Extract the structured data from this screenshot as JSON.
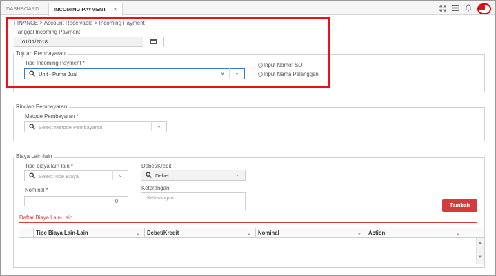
{
  "tabs": {
    "dashboard": "DASHBOARD",
    "incoming": "INCOMING PAYMENT",
    "close": "✕"
  },
  "breadcrumb": "FINANCE > Account Receivable > Incoming Payment",
  "tanggal": {
    "label": "Tanggal Incoming Payment",
    "value": "01/11/2018"
  },
  "tujuan": {
    "legend": "Tujuan Pembayaran",
    "tipe_label": "Tipe Incoming Payment *",
    "tipe_value": "Unit - Purna Jual",
    "radio_so": "Input Nomor SO",
    "radio_pelanggan": "Input Nama Pelanggan"
  },
  "rincian": {
    "legend": "Rincian Pembayaran",
    "metode_label": "Metode Pembayaran *",
    "metode_placeholder": "Select Metode Pembayaran"
  },
  "biaya": {
    "legend": "Biaya Lain-lain",
    "tipe_label": "Tipe biaya lain-lain *",
    "tipe_placeholder": "Select Tipe Biaya",
    "debet_label": "Debet/Kredit",
    "debet_value": "Debet",
    "nominal_label": "Nominal *",
    "nominal_value": "0",
    "keterangan_label": "Keterangan",
    "keterangan_placeholder": "Keterangan",
    "tambah": "Tambah",
    "daftar": "Daftar Biaya Lain-Lain"
  },
  "table": {
    "columns": [
      "Tipe Biaya Lain-Lain",
      "Debet/Kredit",
      "Nominal",
      "Action"
    ]
  },
  "colors": {
    "accent_red": "#d23c3c",
    "highlight_box": "#e11111"
  }
}
